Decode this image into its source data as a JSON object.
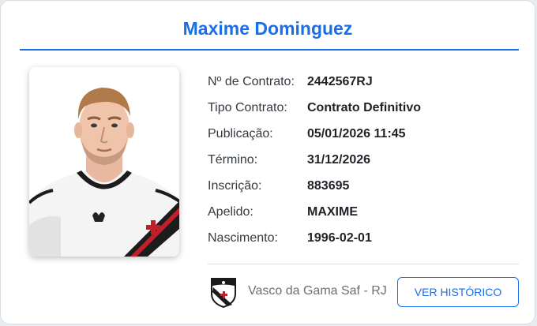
{
  "player": {
    "name": "Maxime Dominguez",
    "photo_alt": "player-photo"
  },
  "details": [
    {
      "label": "Nº de Contrato:",
      "value": "2442567RJ"
    },
    {
      "label": "Tipo Contrato:",
      "value": "Contrato Definitivo"
    },
    {
      "label": "Publicação:",
      "value": "05/01/2026 11:45"
    },
    {
      "label": "Término:",
      "value": "31/12/2026"
    },
    {
      "label": "Inscrição:",
      "value": "883695"
    },
    {
      "label": "Apelido:",
      "value": "MAXIME"
    },
    {
      "label": "Nascimento:",
      "value": "1996-02-01"
    }
  ],
  "club": {
    "name": "Vasco da Gama Saf - RJ",
    "crest_icon": "vasco-crest-icon"
  },
  "actions": {
    "history_label": "VER HISTÓRICO"
  },
  "colors": {
    "accent": "#1a6ee6",
    "label_text": "#333a40",
    "value_text": "#1f2226",
    "muted_text": "#6a7075"
  }
}
